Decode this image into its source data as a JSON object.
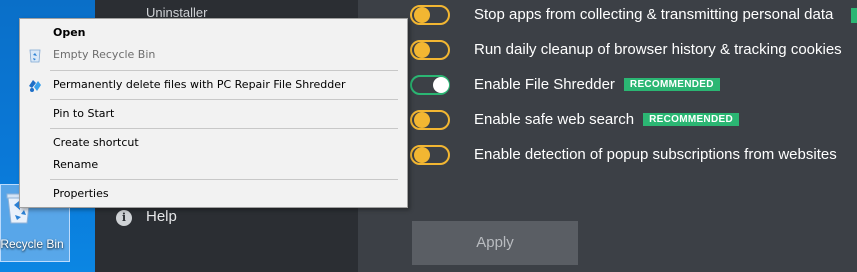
{
  "desktop": {
    "icon_label": "Recycle Bin",
    "icon_name": "recycle-bin-icon"
  },
  "sidebar": {
    "items": [
      {
        "label": "Uninstaller"
      },
      {
        "label": "Help",
        "icon": "info-icon"
      }
    ]
  },
  "settings": [
    {
      "label": "Stop apps from collecting & transmitting personal data",
      "state": "off",
      "badge": ""
    },
    {
      "label": "Run daily cleanup of browser history & tracking cookies",
      "state": "off",
      "badge": ""
    },
    {
      "label": "Enable File Shredder",
      "state": "on",
      "badge": "RECOMMENDED"
    },
    {
      "label": "Enable safe web search",
      "state": "off",
      "badge": "RECOMMENDED"
    },
    {
      "label": "Enable detection of popup subscriptions from websites",
      "state": "off",
      "badge": ""
    }
  ],
  "apply_label": "Apply",
  "context_menu": {
    "items": [
      {
        "label": "Open",
        "style": "bold"
      },
      {
        "label": "Empty Recycle Bin",
        "style": "disabled",
        "icon": "recycle-bin-icon"
      },
      {
        "label": "Permanently delete files with PC Repair File Shredder",
        "icon": "pc-repair-icon"
      },
      {
        "label": "Pin to Start"
      },
      {
        "label": "Create shortcut"
      },
      {
        "label": "Rename"
      },
      {
        "label": "Properties"
      }
    ]
  },
  "colors": {
    "toggle_off": "#f2b632",
    "toggle_on": "#2bb673",
    "badge": "#2bb673",
    "main_bg": "#3c4046",
    "sidebar_bg": "#2b2e33",
    "desktop_bg": "#0a79d8"
  }
}
